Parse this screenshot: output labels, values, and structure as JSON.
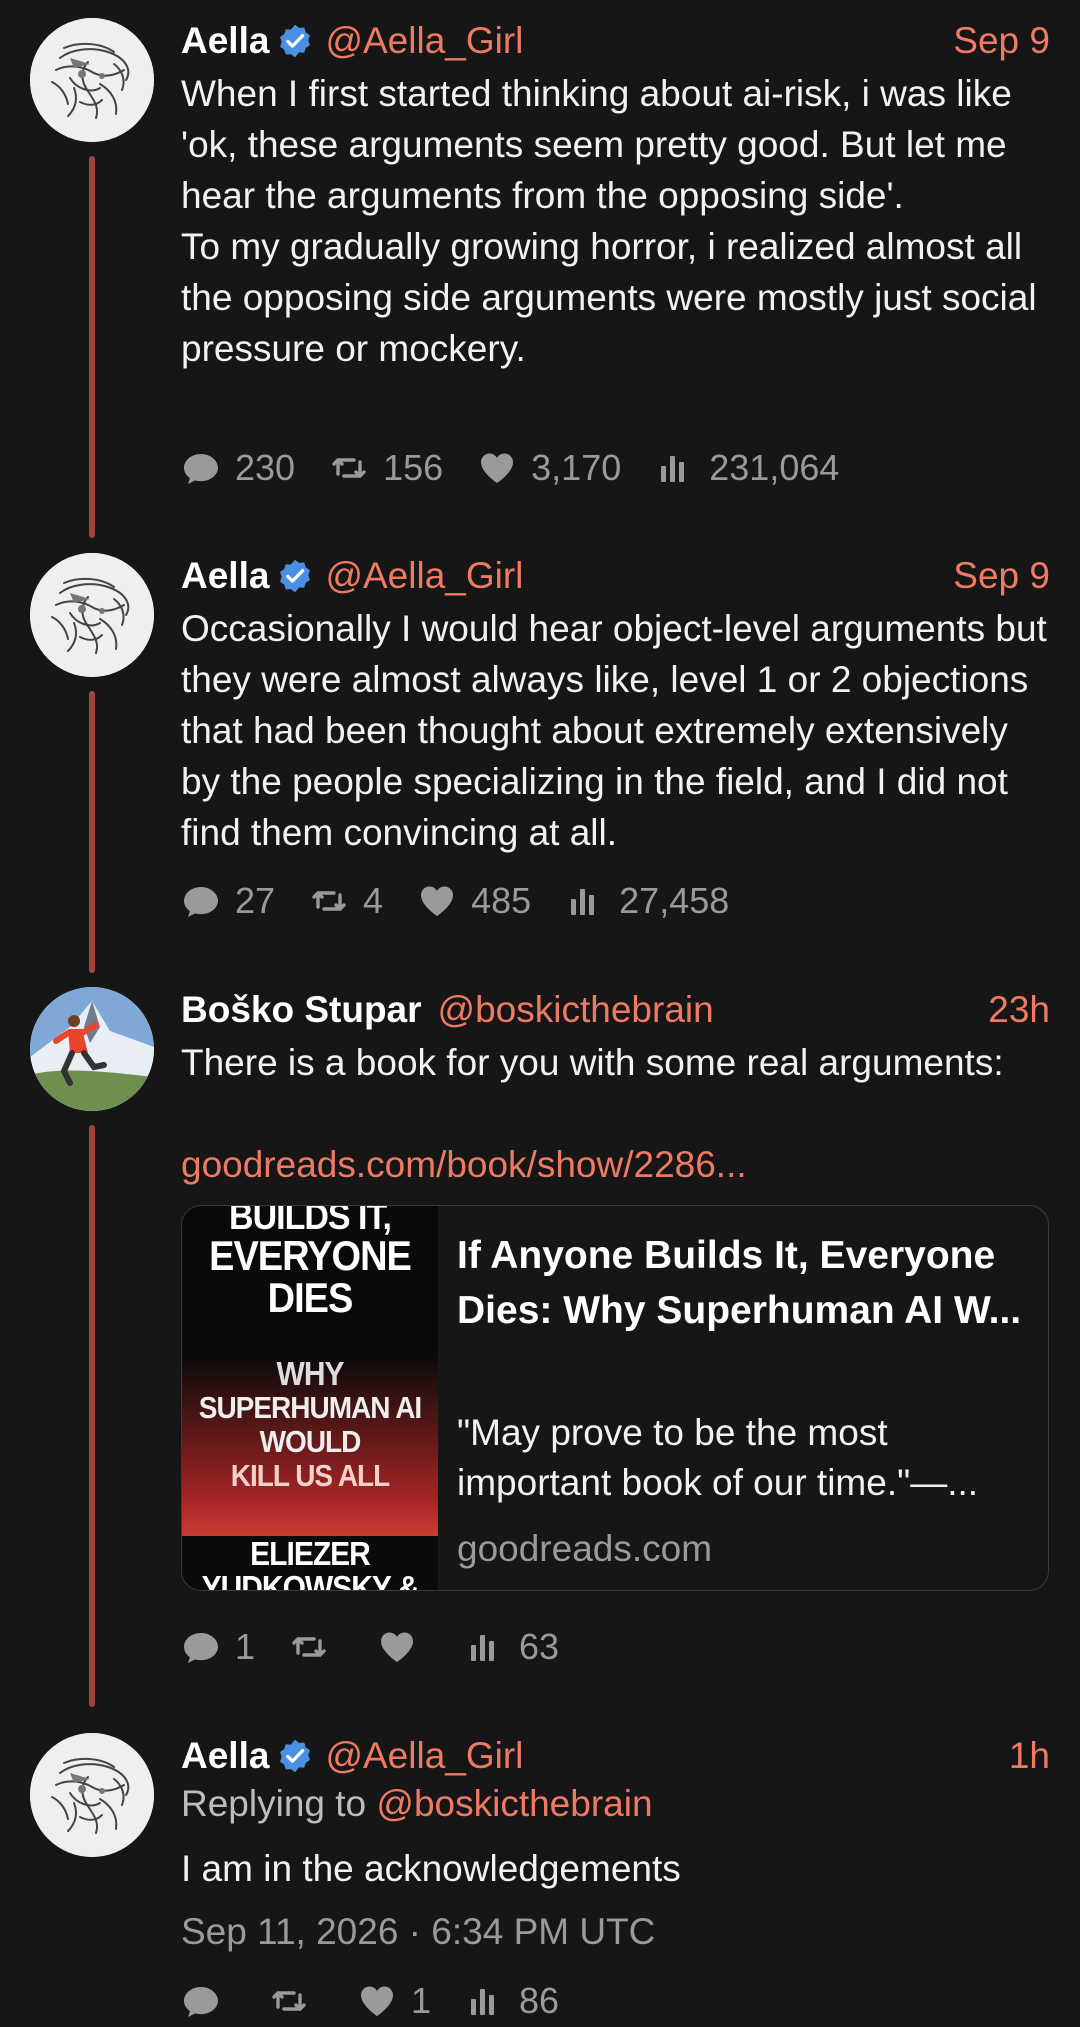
{
  "colors": {
    "accent": "#ef7a63",
    "thread_line": "#a0443c",
    "background": "#161616",
    "muted": "#9a9a9a",
    "verified": "#4a90e2"
  },
  "tweets": [
    {
      "name": "Aella",
      "handle": "@Aella_Girl",
      "date": "Sep 9",
      "text": "When I first started thinking about ai-risk, i was like 'ok, these arguments seem pretty good. But let me hear the arguments from the opposing side'.\nTo my gradually growing horror, i realized almost all the opposing side arguments were mostly just social pressure or mockery.",
      "stats": {
        "replies": "230",
        "retweets": "156",
        "likes": "3,170",
        "views": "231,064"
      }
    },
    {
      "name": "Aella",
      "handle": "@Aella_Girl",
      "date": "Sep 9",
      "text": "Occasionally I would hear object-level arguments but they were almost always like, level 1 or 2 objections that had been thought about extremely extensively by the people specializing in the field, and I did not find them convincing at all.",
      "stats": {
        "replies": "27",
        "retweets": "4",
        "likes": "485",
        "views": "27,458"
      }
    },
    {
      "name": "Boško Stupar",
      "handle": "@boskicthebrain",
      "date": "23h",
      "text": "There is a book for you with some real arguments:",
      "link": "goodreads.com/book/show/2286...",
      "card": {
        "title": "If Anyone Builds It, Everyone Dies: Why Superhuman AI W...",
        "description": "\"May prove to be the most important book of our time.\"—...",
        "domain": "goodreads.com",
        "cover_lines": [
          "BUILDS IT,",
          "EVERYONE",
          "DIES",
          "WHY",
          "SUPERHUMAN AI",
          "WOULD",
          "KILL US ALL",
          "ELIEZER",
          "YUDKOWSKY &"
        ]
      },
      "stats": {
        "replies": "1",
        "retweets": "",
        "likes": "",
        "views": "63"
      }
    },
    {
      "name": "Aella",
      "handle": "@Aella_Girl",
      "date": "1h",
      "replying_label": "Replying to ",
      "replying_to": "@boskicthebrain",
      "text": "I am in the acknowledgements",
      "timestamp": "Sep 11, 2026 · 6:34 PM UTC",
      "stats": {
        "replies": "",
        "retweets": "",
        "likes": "1",
        "views": "86"
      }
    }
  ]
}
